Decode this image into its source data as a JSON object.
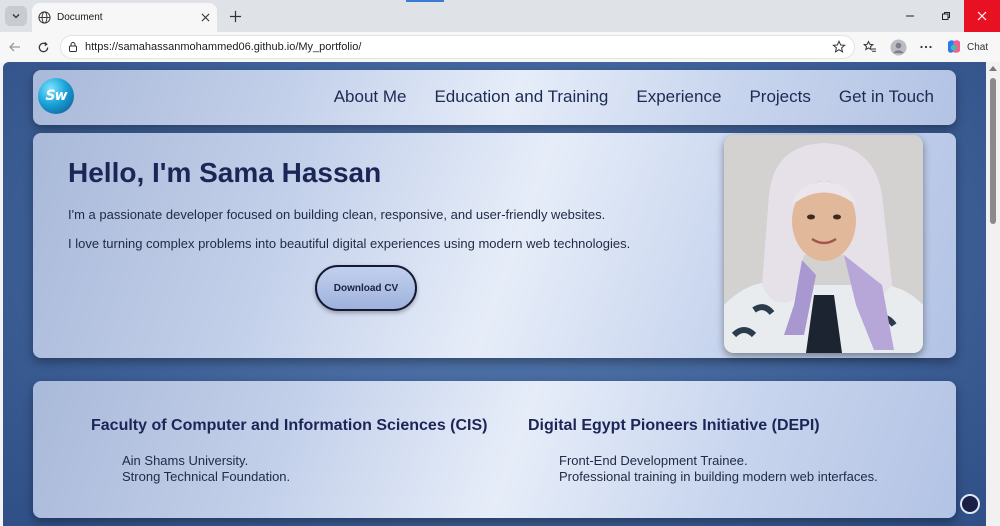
{
  "browser": {
    "tab_title": "Document",
    "url": "https://samahassanmohammed06.github.io/My_portfolio/",
    "chat_label": "Chat"
  },
  "site": {
    "logo_text": "Sw",
    "nav": [
      "About Me",
      "Education and Training",
      "Experience",
      "Projects",
      "Get in Touch"
    ]
  },
  "hero": {
    "title": "Hello, I'm Sama Hassan",
    "paragraph1": "I'm a passionate developer focused on building clean, responsive, and user-friendly websites.",
    "paragraph2": "I love turning complex problems into beautiful digital experiences using modern web technologies.",
    "cv_button": "Download CV"
  },
  "education": [
    {
      "heading": "Faculty of Computer and Information Sciences (CIS)",
      "lines": [
        "Ain Shams University.",
        "Strong Technical Foundation."
      ]
    },
    {
      "heading": "Digital Egypt Pioneers Initiative (DEPI)",
      "lines": [
        "Front-End Development Trainee.",
        "Professional training in building modern web interfaces."
      ]
    }
  ],
  "icons": {
    "tab_list": "chevron-down-icon",
    "tab_favicon": "globe-icon",
    "tab_close": "close-icon",
    "new_tab": "plus-icon",
    "back": "back-arrow-icon",
    "reload": "reload-icon",
    "site_info": "site-info-icon",
    "favorite": "star-icon",
    "favorites_bar": "favorites-icon",
    "profile": "profile-icon",
    "more": "more-icon",
    "copilot": "copilot-icon",
    "scroll_top": "circle-icon"
  },
  "colors": {
    "page_bg": "#3f6299",
    "heading": "#1d2556",
    "close_btn": "#e81123"
  }
}
